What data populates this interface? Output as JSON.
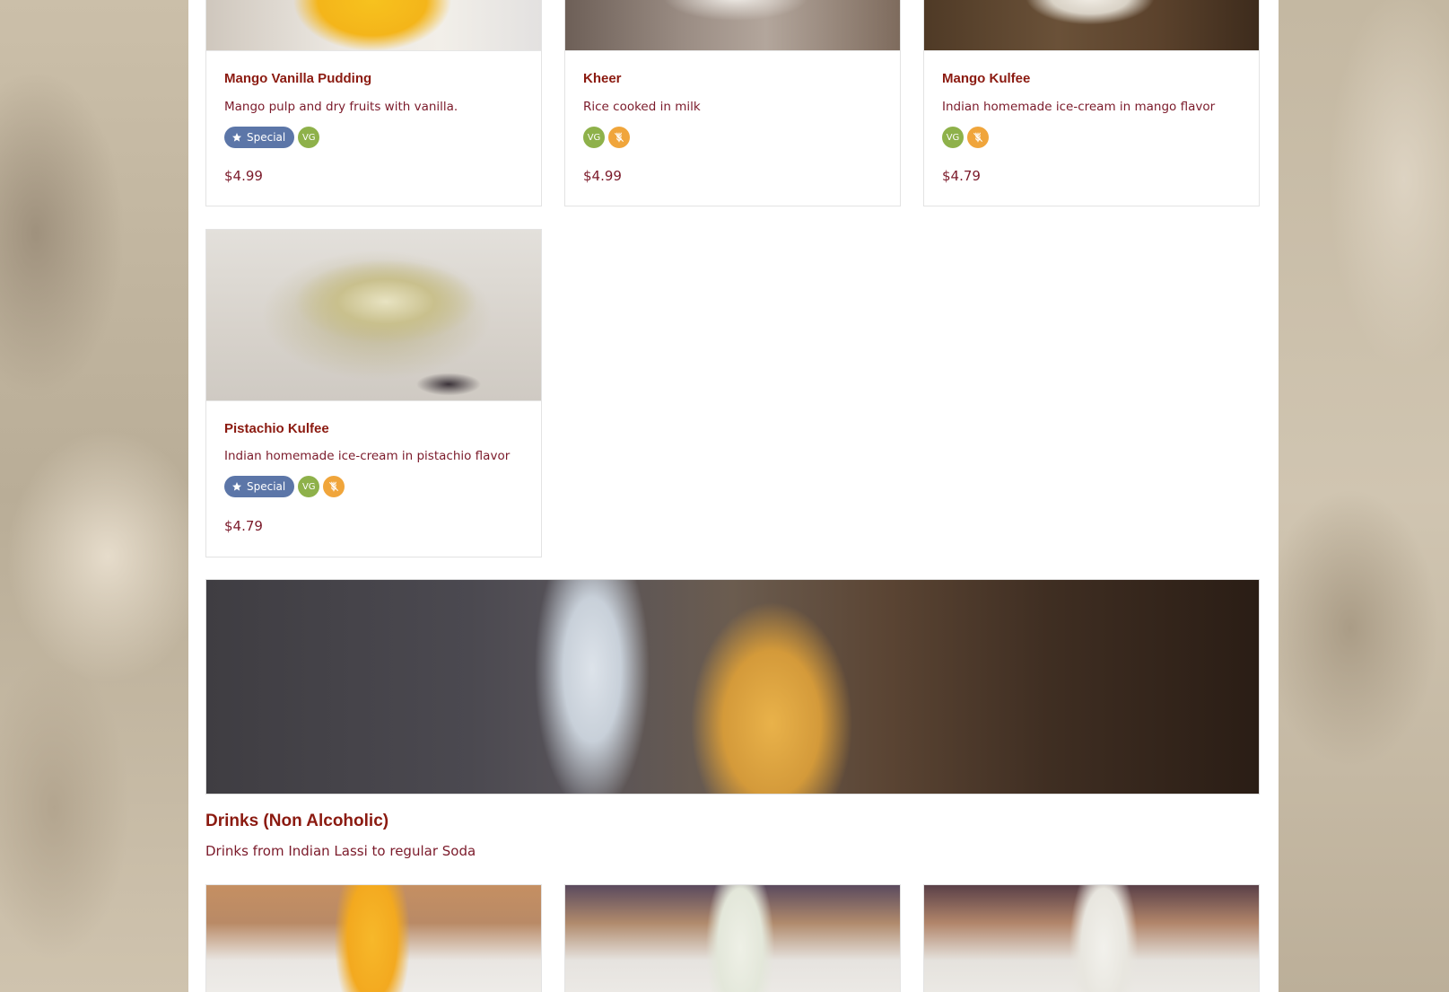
{
  "desserts": [
    {
      "title": "Mango Vanilla Pudding",
      "description": "Mango pulp and dry fruits with vanilla.",
      "special_label": "Special",
      "vg_label": "VG",
      "price": "$4.99",
      "photo_icon": "mango-pudding-photo"
    },
    {
      "title": "Kheer",
      "description": "Rice cooked in milk",
      "vg_label": "VG",
      "price": "$4.99",
      "photo_icon": "kheer-photo"
    },
    {
      "title": "Mango Kulfee",
      "description": "Indian homemade ice-cream in mango flavor",
      "vg_label": "VG",
      "price": "$4.79",
      "photo_icon": "mango-kulfee-photo"
    },
    {
      "title": "Pistachio Kulfee",
      "description": "Indian homemade ice-cream in pistachio flavor",
      "special_label": "Special",
      "vg_label": "VG",
      "price": "$4.79",
      "photo_icon": "pistachio-kulfee-photo"
    }
  ],
  "drinks_section": {
    "title": "Drinks (Non Alcoholic)",
    "description": "Drinks from Indian Lassi to regular Soda"
  },
  "colors": {
    "title": "#8b1a10",
    "text": "#7b1a2a",
    "special_badge": "#5c76a8",
    "vg_badge": "#8eb14a",
    "gluten_free_badge": "#f0a53b"
  }
}
